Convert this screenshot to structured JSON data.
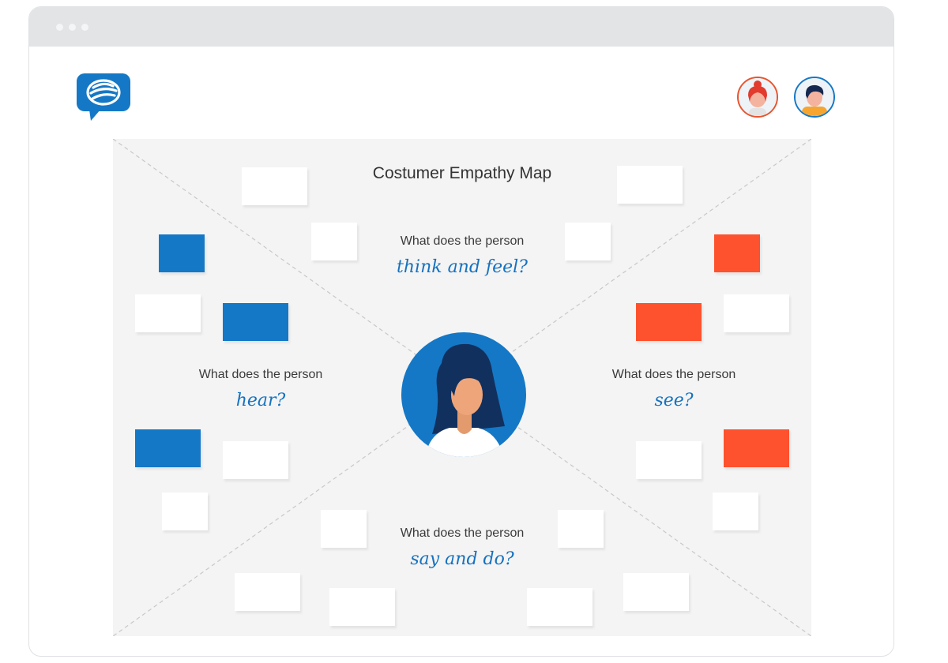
{
  "colors": {
    "accent_blue": "#1478c6",
    "accent_red": "#fe512d",
    "board_bg": "#f4f4f4",
    "window_bar": "#e2e4e6"
  },
  "window": {
    "controls": [
      "dot",
      "dot",
      "dot"
    ]
  },
  "header": {
    "logo_icon": "chat-bubble-logo-icon",
    "collaborators": [
      {
        "name": "collaborator-avatar-female",
        "ring_color": "#e8552d"
      },
      {
        "name": "collaborator-avatar-male",
        "ring_color": "#1478c6"
      }
    ]
  },
  "board": {
    "title": "Costumer Empathy Map",
    "quadrants": {
      "top": {
        "prompt": "What does the person",
        "handwritten": "think and feel?"
      },
      "left": {
        "prompt": "What does the person",
        "handwritten": "hear?"
      },
      "right": {
        "prompt": "What does the person",
        "handwritten": "see?"
      },
      "bottom": {
        "prompt": "What does the person",
        "handwritten": "say and do?"
      }
    },
    "center_icon": "persona-avatar-icon"
  }
}
